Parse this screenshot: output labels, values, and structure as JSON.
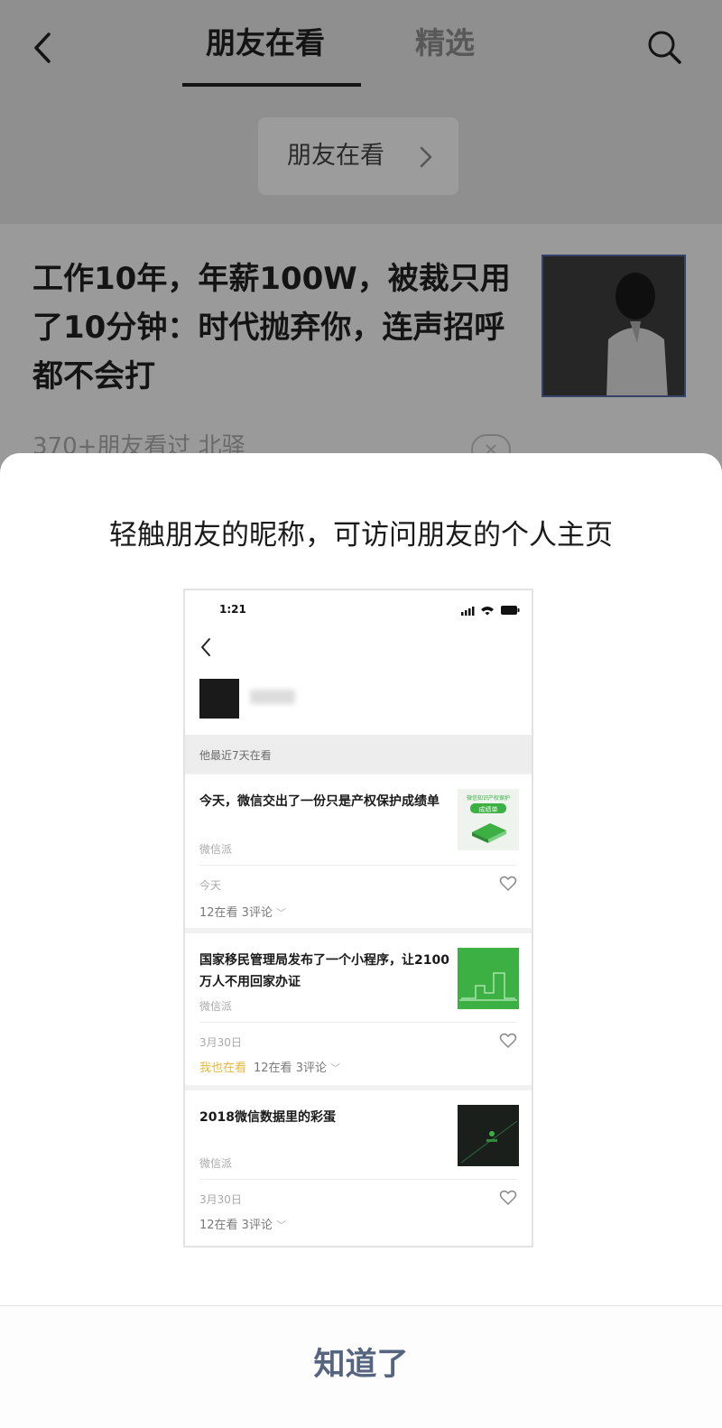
{
  "header": {
    "tabs": [
      {
        "label": "朋友在看",
        "active": true
      },
      {
        "label": "精选",
        "active": false
      }
    ],
    "filter_pill": "朋友在看"
  },
  "article": {
    "title": "工作10年，年薪100W，被裁只用了10分钟：时代抛弃你，连声招呼都不会打",
    "meta": "370+朋友看过 北驿"
  },
  "modal": {
    "heading": "轻触朋友的昵称，可访问朋友的个人主页",
    "ok_label": "知道了"
  },
  "preview": {
    "time": "1:21",
    "section_label": "他最近7天在看",
    "cards": [
      {
        "title": "今天，微信交出了一份只是产权保护成绩单",
        "source": "微信派",
        "date": "今天",
        "me_watching": "",
        "stats": "12在看  3评论",
        "thumb_text": "微信知识产权保护",
        "thumb_badge": "成绩单"
      },
      {
        "title": "国家移民管理局发布了一个小程序，让2100万人不用回家办证",
        "source": "微信派",
        "date": "3月30日",
        "me_watching": "我也在看",
        "stats": "12在看  3评论"
      },
      {
        "title": "2018微信数据里的彩蛋",
        "source": "微信派",
        "date": "3月30日",
        "me_watching": "",
        "stats": "12在看  3评论"
      }
    ]
  },
  "colors": {
    "overlay_gray": "#9a9a9a",
    "ok_text": "#55657f",
    "me_watching": "#e8b839",
    "wechat_green": "#3cb043"
  },
  "icons": [
    "back-arrow-icon",
    "search-icon",
    "chevron-right-icon",
    "close-icon",
    "heart-icon",
    "signal-icon",
    "wifi-icon",
    "battery-icon"
  ]
}
